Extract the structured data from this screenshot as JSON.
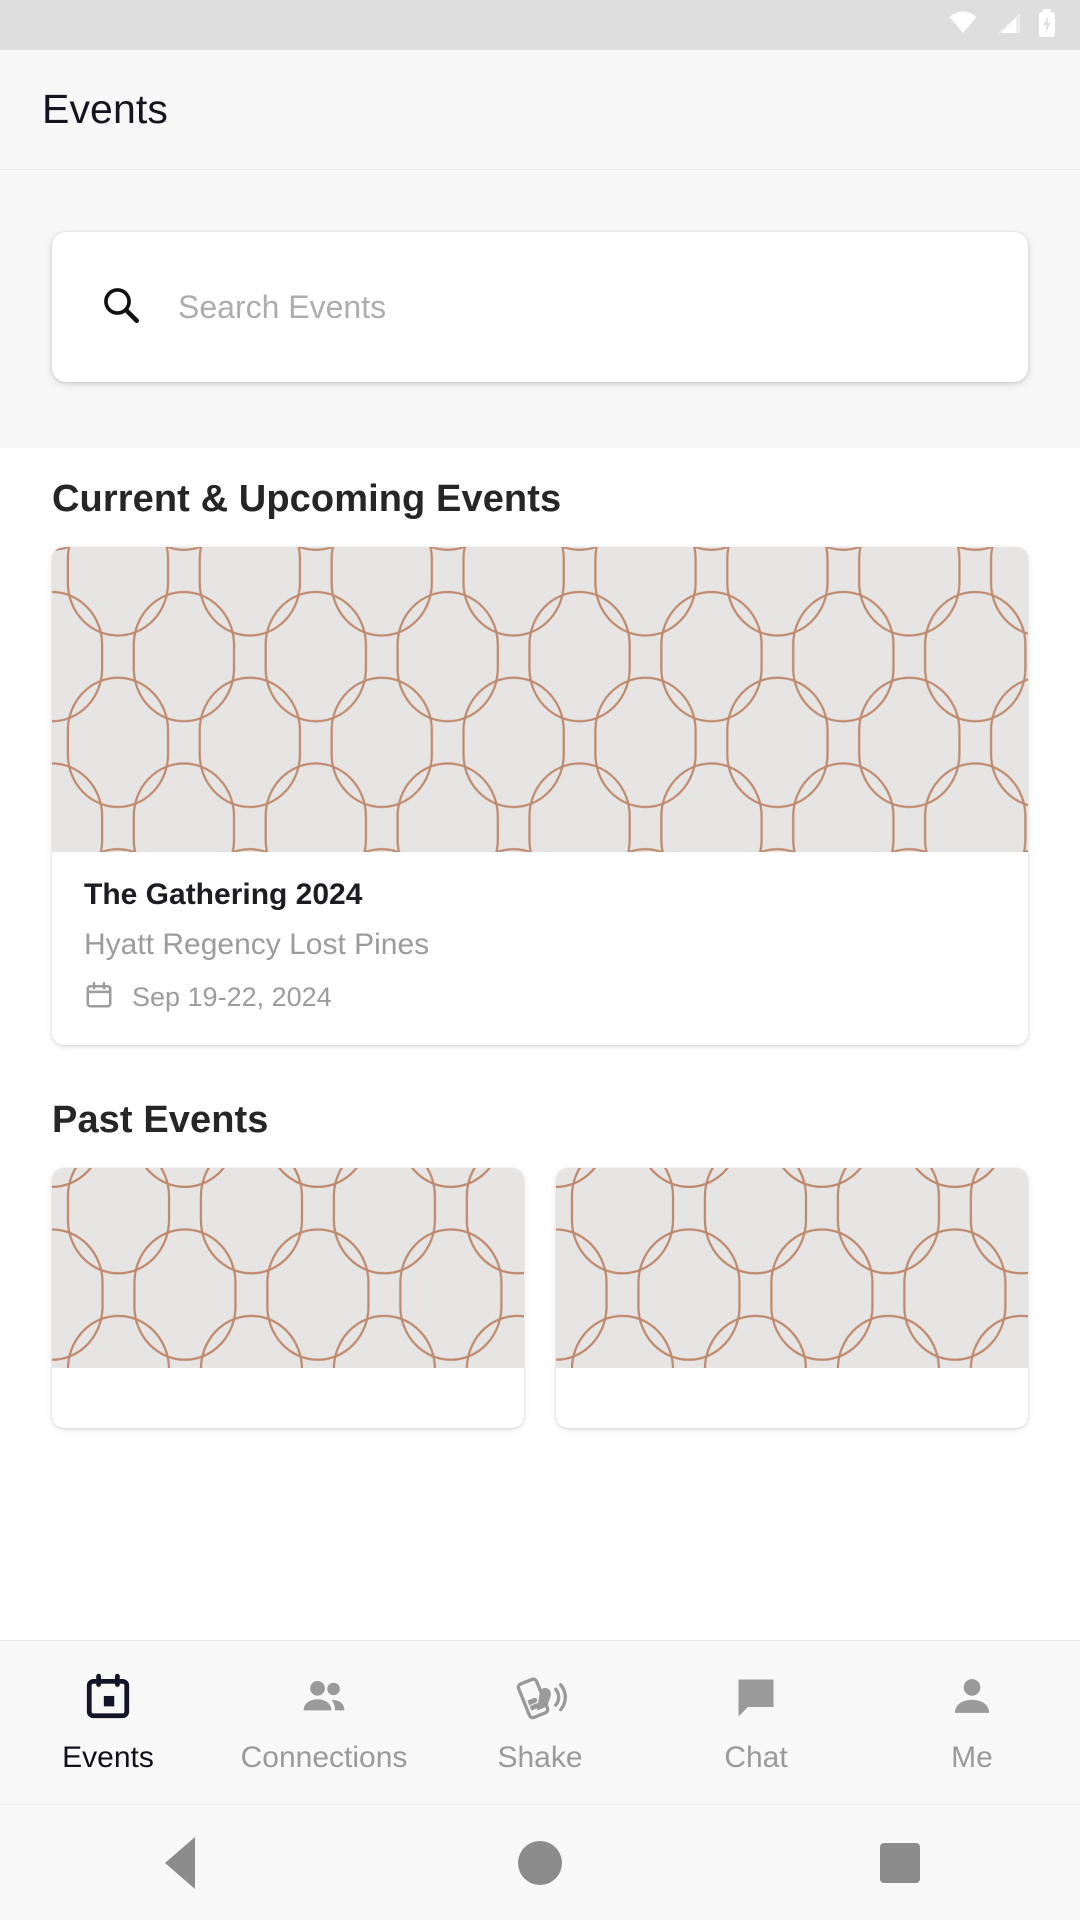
{
  "status_bar": {
    "icons": [
      "wifi-icon",
      "cell-signal-icon",
      "battery-charging-icon"
    ],
    "background": "#dedede"
  },
  "app_bar": {
    "title": "Events",
    "background": "#f7f7f7"
  },
  "search": {
    "placeholder": "Search Events",
    "value": "",
    "icon": "search-icon"
  },
  "sections": {
    "current_title": "Current & Upcoming Events",
    "past_title": "Past Events"
  },
  "featured_event": {
    "title": "The Gathering 2024",
    "venue": "Hyatt Regency Lost Pines",
    "date": "Sep 19-22, 2024",
    "date_icon": "calendar-icon"
  },
  "past_events": [
    {
      "title": "",
      "venue": "",
      "date": ""
    },
    {
      "title": "",
      "venue": "",
      "date": ""
    }
  ],
  "bottom_nav": {
    "items": [
      {
        "label": "Events",
        "icon": "calendar-icon",
        "active": true
      },
      {
        "label": "Connections",
        "icon": "people-icon",
        "active": false
      },
      {
        "label": "Shake",
        "icon": "shake-hand-phone-icon",
        "active": false
      },
      {
        "label": "Chat",
        "icon": "chat-bubble-icon",
        "active": false
      },
      {
        "label": "Me",
        "icon": "person-icon",
        "active": false
      }
    ]
  },
  "system_nav": {
    "back": "back-button",
    "home": "home-button",
    "recents": "recents-button"
  },
  "colors": {
    "accent_pattern": "#c08a6e",
    "artwork_bg": "#e6e5e3",
    "active_nav": "#101018",
    "inactive_nav": "#9a9a9a",
    "page_bg": "#ffffff",
    "panel_bg": "#f7f7f7"
  }
}
